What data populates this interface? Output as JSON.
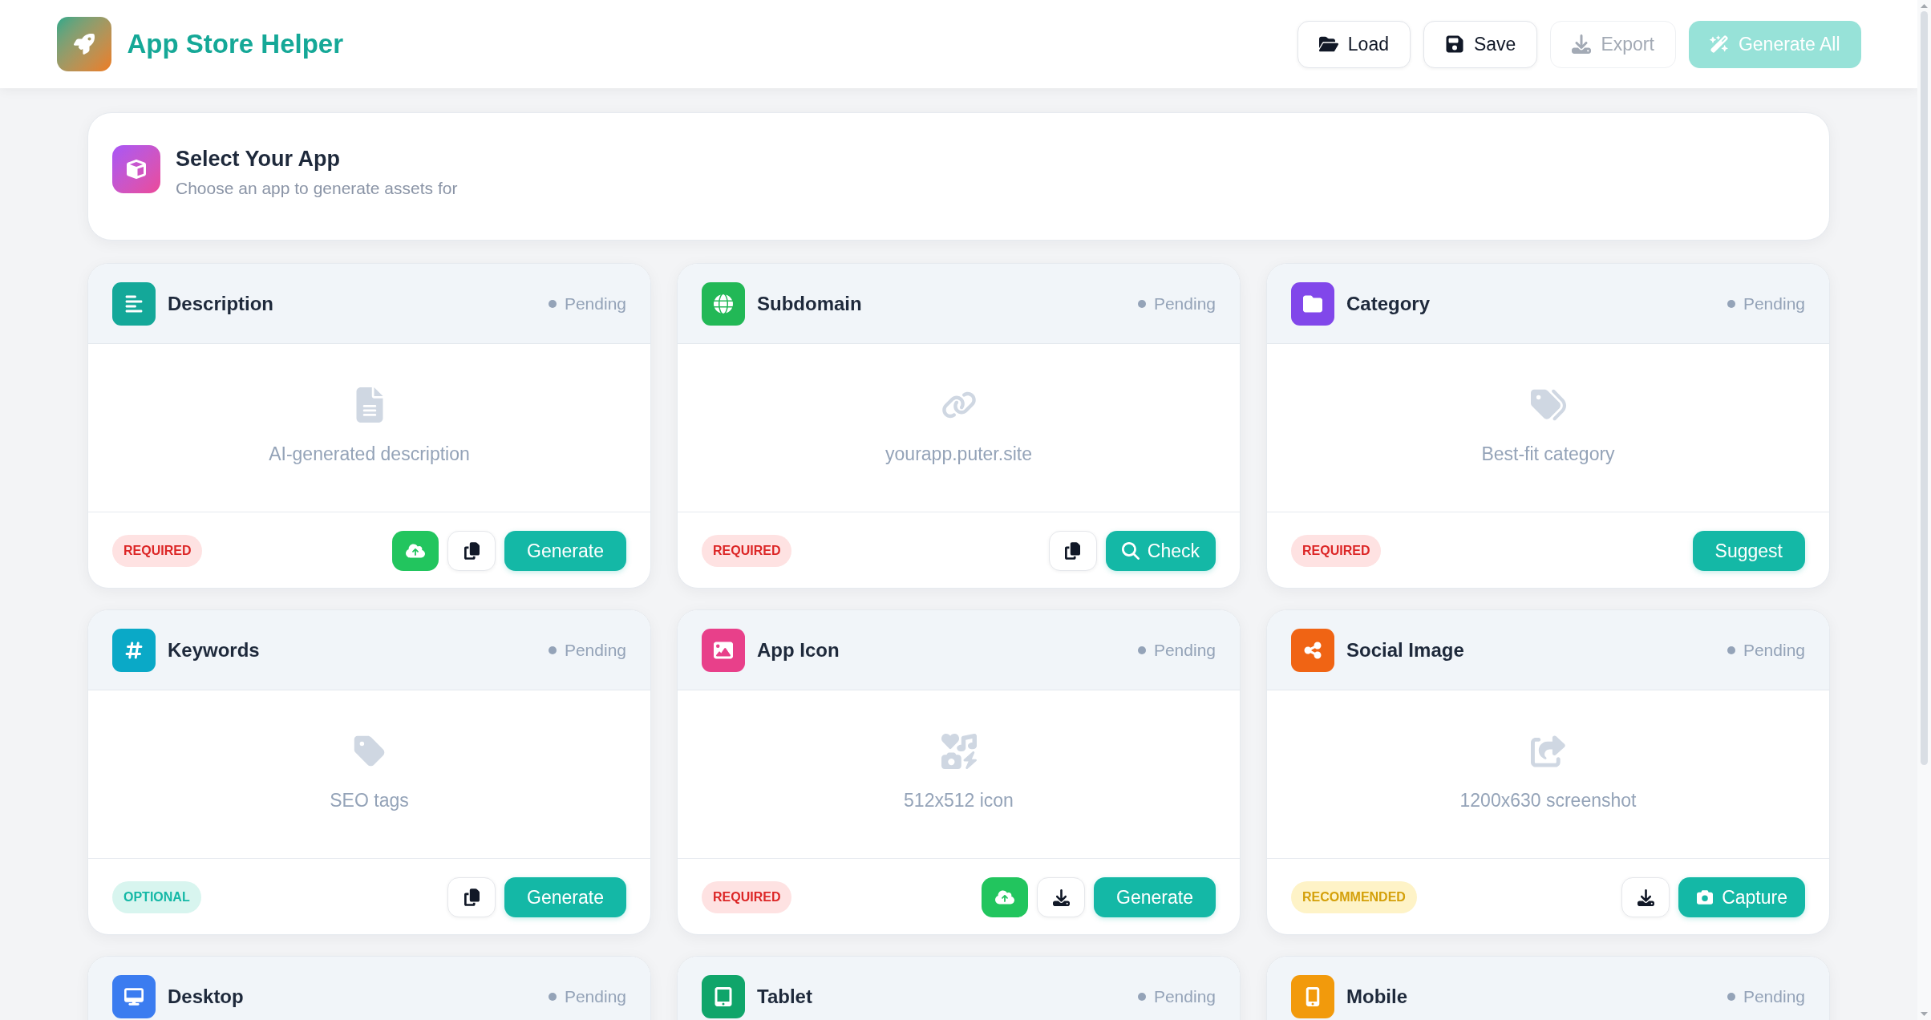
{
  "header": {
    "title": "App Store Helper",
    "buttons": [
      {
        "label": "Load",
        "kind": "load",
        "disabled": false
      },
      {
        "label": "Save",
        "kind": "save",
        "disabled": false
      },
      {
        "label": "Export",
        "kind": "export",
        "disabled": true
      },
      {
        "label": "Generate All",
        "kind": "generate",
        "disabled": true
      }
    ]
  },
  "app_select": {
    "title": "Select Your App",
    "subtitle": "Choose an app to generate assets for"
  },
  "cards": [
    {
      "kind": "description",
      "title": "Description",
      "color": "#14a899",
      "status": "Pending",
      "hint": "AI-generated description",
      "badge": {
        "label": "REQUIRED",
        "kind": "required"
      },
      "actions": [
        {
          "kind": "upload"
        },
        {
          "kind": "copy"
        },
        {
          "kind": "generate",
          "label": "Generate"
        }
      ]
    },
    {
      "kind": "subdomain",
      "title": "Subdomain",
      "color": "#22b856",
      "status": "Pending",
      "hint": "yourapp.puter.site",
      "badge": {
        "label": "REQUIRED",
        "kind": "required"
      },
      "actions": [
        {
          "kind": "copy"
        },
        {
          "kind": "check",
          "label": "Check"
        }
      ]
    },
    {
      "kind": "category",
      "title": "Category",
      "color": "#8147ea",
      "status": "Pending",
      "hint": "Best-fit category",
      "badge": {
        "label": "REQUIRED",
        "kind": "required"
      },
      "actions": [
        {
          "kind": "suggest",
          "label": "Suggest"
        }
      ]
    },
    {
      "kind": "keywords",
      "title": "Keywords",
      "color": "#0aa9c7",
      "status": "Pending",
      "hint": "SEO tags",
      "badge": {
        "label": "OPTIONAL",
        "kind": "optional"
      },
      "actions": [
        {
          "kind": "copy"
        },
        {
          "kind": "generate",
          "label": "Generate"
        }
      ]
    },
    {
      "kind": "appicon",
      "title": "App Icon",
      "color": "#e8408a",
      "status": "Pending",
      "hint": "512x512 icon",
      "badge": {
        "label": "REQUIRED",
        "kind": "required"
      },
      "actions": [
        {
          "kind": "upload"
        },
        {
          "kind": "download"
        },
        {
          "kind": "generate",
          "label": "Generate"
        }
      ]
    },
    {
      "kind": "social",
      "title": "Social Image",
      "color": "#f06414",
      "status": "Pending",
      "hint": "1200x630 screenshot",
      "badge": {
        "label": "RECOMMENDED",
        "kind": "recommended"
      },
      "actions": [
        {
          "kind": "download"
        },
        {
          "kind": "capture",
          "label": "Capture"
        }
      ]
    },
    {
      "kind": "desktop",
      "title": "Desktop",
      "color": "#3b7cf0",
      "status": "Pending"
    },
    {
      "kind": "tablet",
      "title": "Tablet",
      "color": "#10a56a",
      "status": "Pending"
    },
    {
      "kind": "mobile",
      "title": "Mobile",
      "color": "#f29a0c",
      "status": "Pending"
    }
  ]
}
